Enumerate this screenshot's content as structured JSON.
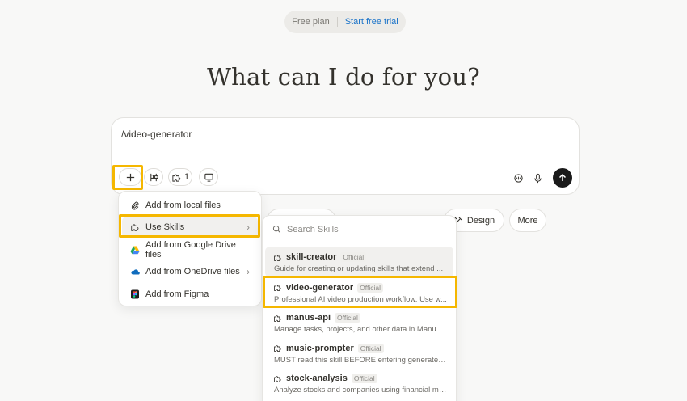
{
  "plan": {
    "label": "Free plan",
    "cta": "Start free trial"
  },
  "headline": "What can I do for you?",
  "composer": {
    "input_value": "/video-generator",
    "skills_count": "1"
  },
  "chips": [
    {
      "label": "Design",
      "icon": "design-icon"
    },
    {
      "label": "More",
      "icon": ""
    }
  ],
  "attach_menu": {
    "items": [
      {
        "label": "Add from local files",
        "icon": "paperclip-icon",
        "has_submenu": false
      },
      {
        "label": "Use Skills",
        "icon": "puzzle-icon",
        "has_submenu": true
      },
      {
        "label": "Add from Google Drive files",
        "icon": "google-drive-icon",
        "has_submenu": false
      },
      {
        "label": "Add from OneDrive files",
        "icon": "onedrive-icon",
        "has_submenu": true
      },
      {
        "label": "Add from Figma",
        "icon": "figma-icon",
        "has_submenu": false
      }
    ]
  },
  "skills_menu": {
    "search_placeholder": "Search Skills",
    "items": [
      {
        "name": "skill-creator",
        "badge": "Official",
        "desc": "Guide for creating or updating skills that extend ..."
      },
      {
        "name": "video-generator",
        "badge": "Official",
        "desc": "Professional AI video production workflow. Use w..."
      },
      {
        "name": "manus-api",
        "badge": "Official",
        "desc": "Manage tasks, projects, and other data in Manus ..."
      },
      {
        "name": "music-prompter",
        "badge": "Official",
        "desc": "MUST read this skill BEFORE entering generate m..."
      },
      {
        "name": "stock-analysis",
        "badge": "Official",
        "desc": "Analyze stocks and companies using financial ma..."
      }
    ]
  },
  "colors": {
    "highlight": "#f5b700",
    "link": "#1a73c9",
    "send_button": "#1a1a1a"
  }
}
